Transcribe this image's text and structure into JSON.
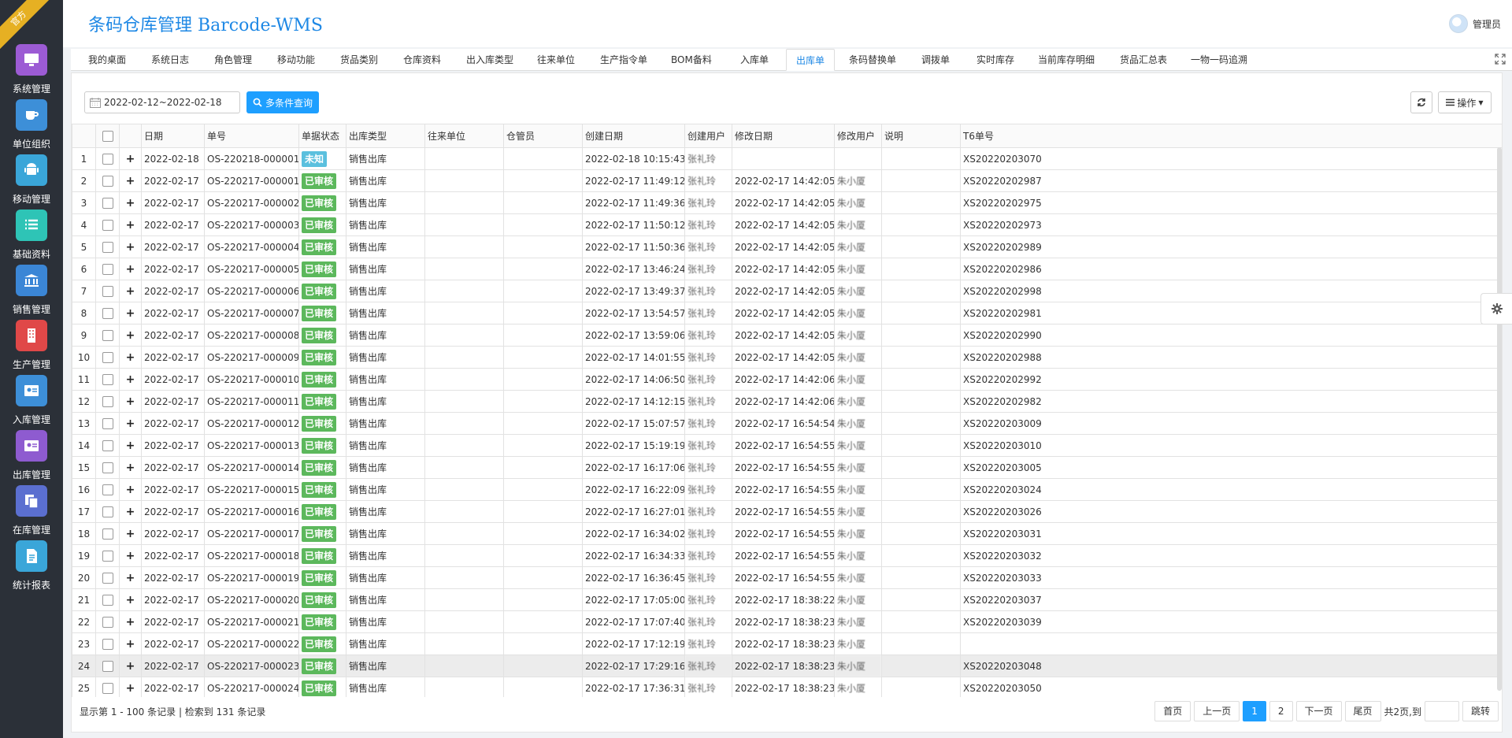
{
  "ribbon": "官方",
  "brand": "条码仓库管理  Barcode-WMS",
  "user": {
    "name": "管理员"
  },
  "sidebar": [
    {
      "label": "系统管理",
      "icon": "monitor-icon",
      "color": "#9c5bd4"
    },
    {
      "label": "单位组织",
      "icon": "coffee-icon",
      "color": "#3d8fd8"
    },
    {
      "label": "移动管理",
      "icon": "android-icon",
      "color": "#3aa6d9"
    },
    {
      "label": "基础资料",
      "icon": "list-icon",
      "color": "#2ec4b6"
    },
    {
      "label": "销售管理",
      "icon": "bank-icon",
      "color": "#3b86d6"
    },
    {
      "label": "生产管理",
      "icon": "building-icon",
      "color": "#e04848"
    },
    {
      "label": "入库管理",
      "icon": "id-card-icon",
      "color": "#3d8fd8"
    },
    {
      "label": "出库管理",
      "icon": "address-card-icon",
      "color": "#8e5bd0"
    },
    {
      "label": "在库管理",
      "icon": "copy-icon",
      "color": "#5b6fd0"
    },
    {
      "label": "统计报表",
      "icon": "file-icon",
      "color": "#3aa6d9"
    }
  ],
  "tabs": [
    "我的桌面",
    "系统日志",
    "角色管理",
    "移动功能",
    "货品类别",
    "仓库资料",
    "出入库类型",
    "往来单位",
    "生产指令单",
    "BOM备料",
    "入库单",
    "出库单",
    "条码替换单",
    "调拨单",
    "实时库存",
    "当前库存明细",
    "货品汇总表",
    "一物一码追溯"
  ],
  "active_tab": "出库单",
  "toolbar": {
    "date_range": "2022-02-12~2022-02-18",
    "search_label": "多条件查询",
    "ops_label": "操作"
  },
  "columns": [
    "",
    "",
    "",
    "日期",
    "单号",
    "单据状态",
    "出库类型",
    "往来单位",
    "仓管员",
    "创建日期",
    "创建用户",
    "修改日期",
    "修改用户",
    "说明",
    "T6单号"
  ],
  "rows": [
    {
      "n": "1",
      "date": "2022-02-18",
      "no": "OS-220218-000001",
      "status": "未知",
      "type": "销售出库",
      "partner": "",
      "keeper": "",
      "created": "2022-02-18 10:15:43",
      "cuser": "张礼玲",
      "modified": "",
      "muser": "",
      "note": "",
      "t6": "XS20220203070"
    },
    {
      "n": "2",
      "date": "2022-02-17",
      "no": "OS-220217-000001",
      "status": "已审核",
      "type": "销售出库",
      "partner": "",
      "keeper": "",
      "created": "2022-02-17 11:49:12",
      "cuser": "张礼玲",
      "modified": "2022-02-17 14:42:05",
      "muser": "朱小厦",
      "note": "",
      "t6": "XS20220202987"
    },
    {
      "n": "3",
      "date": "2022-02-17",
      "no": "OS-220217-000002",
      "status": "已审核",
      "type": "销售出库",
      "partner": "",
      "keeper": "",
      "created": "2022-02-17 11:49:36",
      "cuser": "张礼玲",
      "modified": "2022-02-17 14:42:05",
      "muser": "朱小厦",
      "note": "",
      "t6": "XS20220202975"
    },
    {
      "n": "4",
      "date": "2022-02-17",
      "no": "OS-220217-000003",
      "status": "已审核",
      "type": "销售出库",
      "partner": "",
      "keeper": "",
      "created": "2022-02-17 11:50:12",
      "cuser": "张礼玲",
      "modified": "2022-02-17 14:42:05",
      "muser": "朱小厦",
      "note": "",
      "t6": "XS20220202973"
    },
    {
      "n": "5",
      "date": "2022-02-17",
      "no": "OS-220217-000004",
      "status": "已审核",
      "type": "销售出库",
      "partner": "",
      "keeper": "",
      "created": "2022-02-17 11:50:36",
      "cuser": "张礼玲",
      "modified": "2022-02-17 14:42:05",
      "muser": "朱小厦",
      "note": "",
      "t6": "XS20220202989"
    },
    {
      "n": "6",
      "date": "2022-02-17",
      "no": "OS-220217-000005",
      "status": "已审核",
      "type": "销售出库",
      "partner": "",
      "keeper": "",
      "created": "2022-02-17 13:46:24",
      "cuser": "张礼玲",
      "modified": "2022-02-17 14:42:05",
      "muser": "朱小厦",
      "note": "",
      "t6": "XS20220202986"
    },
    {
      "n": "7",
      "date": "2022-02-17",
      "no": "OS-220217-000006",
      "status": "已审核",
      "type": "销售出库",
      "partner": "",
      "keeper": "",
      "created": "2022-02-17 13:49:37",
      "cuser": "张礼玲",
      "modified": "2022-02-17 14:42:05",
      "muser": "朱小厦",
      "note": "",
      "t6": "XS20220202998"
    },
    {
      "n": "8",
      "date": "2022-02-17",
      "no": "OS-220217-000007",
      "status": "已审核",
      "type": "销售出库",
      "partner": "",
      "keeper": "",
      "created": "2022-02-17 13:54:57",
      "cuser": "张礼玲",
      "modified": "2022-02-17 14:42:05",
      "muser": "朱小厦",
      "note": "",
      "t6": "XS20220202981"
    },
    {
      "n": "9",
      "date": "2022-02-17",
      "no": "OS-220217-000008",
      "status": "已审核",
      "type": "销售出库",
      "partner": "",
      "keeper": "",
      "created": "2022-02-17 13:59:06",
      "cuser": "张礼玲",
      "modified": "2022-02-17 14:42:05",
      "muser": "朱小厦",
      "note": "",
      "t6": "XS20220202990"
    },
    {
      "n": "10",
      "date": "2022-02-17",
      "no": "OS-220217-000009",
      "status": "已审核",
      "type": "销售出库",
      "partner": "",
      "keeper": "",
      "created": "2022-02-17 14:01:55",
      "cuser": "张礼玲",
      "modified": "2022-02-17 14:42:05",
      "muser": "朱小厦",
      "note": "",
      "t6": "XS20220202988"
    },
    {
      "n": "11",
      "date": "2022-02-17",
      "no": "OS-220217-000010",
      "status": "已审核",
      "type": "销售出库",
      "partner": "",
      "keeper": "",
      "created": "2022-02-17 14:06:50",
      "cuser": "张礼玲",
      "modified": "2022-02-17 14:42:06",
      "muser": "朱小厦",
      "note": "",
      "t6": "XS20220202992"
    },
    {
      "n": "12",
      "date": "2022-02-17",
      "no": "OS-220217-000011",
      "status": "已审核",
      "type": "销售出库",
      "partner": "",
      "keeper": "",
      "created": "2022-02-17 14:12:15",
      "cuser": "张礼玲",
      "modified": "2022-02-17 14:42:06",
      "muser": "朱小厦",
      "note": "",
      "t6": "XS20220202982"
    },
    {
      "n": "13",
      "date": "2022-02-17",
      "no": "OS-220217-000012",
      "status": "已审核",
      "type": "销售出库",
      "partner": "",
      "keeper": "",
      "created": "2022-02-17 15:07:57",
      "cuser": "张礼玲",
      "modified": "2022-02-17 16:54:54",
      "muser": "朱小厦",
      "note": "",
      "t6": "XS20220203009"
    },
    {
      "n": "14",
      "date": "2022-02-17",
      "no": "OS-220217-000013",
      "status": "已审核",
      "type": "销售出库",
      "partner": "",
      "keeper": "",
      "created": "2022-02-17 15:19:19",
      "cuser": "张礼玲",
      "modified": "2022-02-17 16:54:55",
      "muser": "朱小厦",
      "note": "",
      "t6": "XS20220203010"
    },
    {
      "n": "15",
      "date": "2022-02-17",
      "no": "OS-220217-000014",
      "status": "已审核",
      "type": "销售出库",
      "partner": "",
      "keeper": "",
      "created": "2022-02-17 16:17:06",
      "cuser": "张礼玲",
      "modified": "2022-02-17 16:54:55",
      "muser": "朱小厦",
      "note": "",
      "t6": "XS20220203005"
    },
    {
      "n": "16",
      "date": "2022-02-17",
      "no": "OS-220217-000015",
      "status": "已审核",
      "type": "销售出库",
      "partner": "",
      "keeper": "",
      "created": "2022-02-17 16:22:09",
      "cuser": "张礼玲",
      "modified": "2022-02-17 16:54:55",
      "muser": "朱小厦",
      "note": "",
      "t6": "XS20220203024"
    },
    {
      "n": "17",
      "date": "2022-02-17",
      "no": "OS-220217-000016",
      "status": "已审核",
      "type": "销售出库",
      "partner": "",
      "keeper": "",
      "created": "2022-02-17 16:27:01",
      "cuser": "张礼玲",
      "modified": "2022-02-17 16:54:55",
      "muser": "朱小厦",
      "note": "",
      "t6": "XS20220203026"
    },
    {
      "n": "18",
      "date": "2022-02-17",
      "no": "OS-220217-000017",
      "status": "已审核",
      "type": "销售出库",
      "partner": "",
      "keeper": "",
      "created": "2022-02-17 16:34:02",
      "cuser": "张礼玲",
      "modified": "2022-02-17 16:54:55",
      "muser": "朱小厦",
      "note": "",
      "t6": "XS20220203031"
    },
    {
      "n": "19",
      "date": "2022-02-17",
      "no": "OS-220217-000018",
      "status": "已审核",
      "type": "销售出库",
      "partner": "",
      "keeper": "",
      "created": "2022-02-17 16:34:33",
      "cuser": "张礼玲",
      "modified": "2022-02-17 16:54:55",
      "muser": "朱小厦",
      "note": "",
      "t6": "XS20220203032"
    },
    {
      "n": "20",
      "date": "2022-02-17",
      "no": "OS-220217-000019",
      "status": "已审核",
      "type": "销售出库",
      "partner": "",
      "keeper": "",
      "created": "2022-02-17 16:36:45",
      "cuser": "张礼玲",
      "modified": "2022-02-17 16:54:55",
      "muser": "朱小厦",
      "note": "",
      "t6": "XS20220203033"
    },
    {
      "n": "21",
      "date": "2022-02-17",
      "no": "OS-220217-000020",
      "status": "已审核",
      "type": "销售出库",
      "partner": "",
      "keeper": "",
      "created": "2022-02-17 17:05:00",
      "cuser": "张礼玲",
      "modified": "2022-02-17 18:38:22",
      "muser": "朱小厦",
      "note": "",
      "t6": "XS20220203037"
    },
    {
      "n": "22",
      "date": "2022-02-17",
      "no": "OS-220217-000021",
      "status": "已审核",
      "type": "销售出库",
      "partner": "",
      "keeper": "",
      "created": "2022-02-17 17:07:40",
      "cuser": "张礼玲",
      "modified": "2022-02-17 18:38:23",
      "muser": "朱小厦",
      "note": "",
      "t6": "XS20220203039"
    },
    {
      "n": "23",
      "date": "2022-02-17",
      "no": "OS-220217-000022",
      "status": "已审核",
      "type": "销售出库",
      "partner": "",
      "keeper": "",
      "created": "2022-02-17 17:12:19",
      "cuser": "张礼玲",
      "modified": "2022-02-17 18:38:23",
      "muser": "朱小厦",
      "note": "",
      "t6": ""
    },
    {
      "n": "24",
      "date": "2022-02-17",
      "no": "OS-220217-000023",
      "status": "已审核",
      "type": "销售出库",
      "partner": "",
      "keeper": "",
      "created": "2022-02-17 17:29:16",
      "cuser": "张礼玲",
      "modified": "2022-02-17 18:38:23",
      "muser": "朱小厦",
      "note": "",
      "t6": "XS20220203048"
    },
    {
      "n": "25",
      "date": "2022-02-17",
      "no": "OS-220217-000024",
      "status": "已审核",
      "type": "销售出库",
      "partner": "",
      "keeper": "",
      "created": "2022-02-17 17:36:31",
      "cuser": "张礼玲",
      "modified": "2022-02-17 18:38:23",
      "muser": "朱小厦",
      "note": "",
      "t6": "XS20220203050"
    }
  ],
  "highlighted_row": "24",
  "footer": {
    "info": "显示第 1 - 100 条记录 | 检索到 131 条记录",
    "first": "首页",
    "prev": "上一页",
    "pages": [
      "1",
      "2"
    ],
    "current_page": "1",
    "next": "下一页",
    "last": "尾页",
    "total": "共2页,到",
    "jump": "跳转"
  },
  "colors": {
    "accent": "#1e9fff",
    "approved": "#5cb85c",
    "unknown": "#5bc0de",
    "sidebar_bg": "#2b3038"
  }
}
